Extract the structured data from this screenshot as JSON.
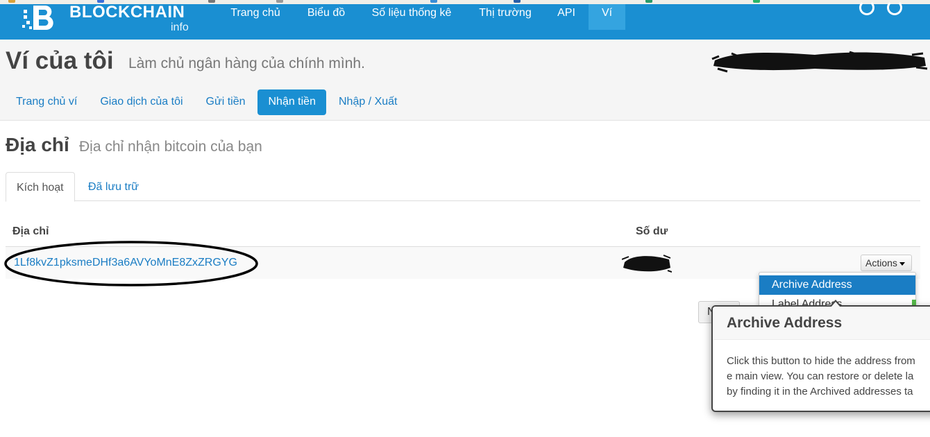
{
  "brand": {
    "name": "BLOCKCHAIN",
    "sub": "info"
  },
  "nav": [
    {
      "label": "Trang chủ"
    },
    {
      "label": "Biểu đồ"
    },
    {
      "label": "Số liệu thống kê"
    },
    {
      "label": "Thị trường"
    },
    {
      "label": "API"
    },
    {
      "label": "Ví",
      "active": true
    }
  ],
  "header": {
    "title": "Ví của tôi",
    "subtitle": "Làm chủ ngân hàng của chính mình."
  },
  "subnav": [
    {
      "label": "Trang chủ ví"
    },
    {
      "label": "Giao dịch của tôi"
    },
    {
      "label": "Gửi tiền"
    },
    {
      "label": "Nhận tiền",
      "active": true
    },
    {
      "label": "Nhập / Xuất"
    }
  ],
  "section": {
    "title": "Địa chỉ",
    "subtitle": "Địa chỉ nhận bitcoin của bạn"
  },
  "tabs": {
    "active": "Kích hoạt",
    "archived": "Đã lưu trữ"
  },
  "table": {
    "col_address": "Địa chỉ",
    "col_balance": "Số dư",
    "rows": [
      {
        "address": "1Lf8kvZ1pksmeDHf3a6AVYoMnE8ZxZRGYG",
        "balance": "",
        "actions_label": "Actions"
      }
    ]
  },
  "dropdown": {
    "items": [
      "Archive Address",
      "Label Address"
    ]
  },
  "partial_button": {
    "label": "N"
  },
  "popover": {
    "title": "Archive Address",
    "lines": [
      "Click this button to hide the address from",
      "e main view. You can restore or delete la",
      "by finding it in the Archived addresses ta"
    ]
  },
  "colors": {
    "navbar": "#1a8fd2",
    "link": "#1a7dc4",
    "header_bg": "#f5f5f5"
  }
}
